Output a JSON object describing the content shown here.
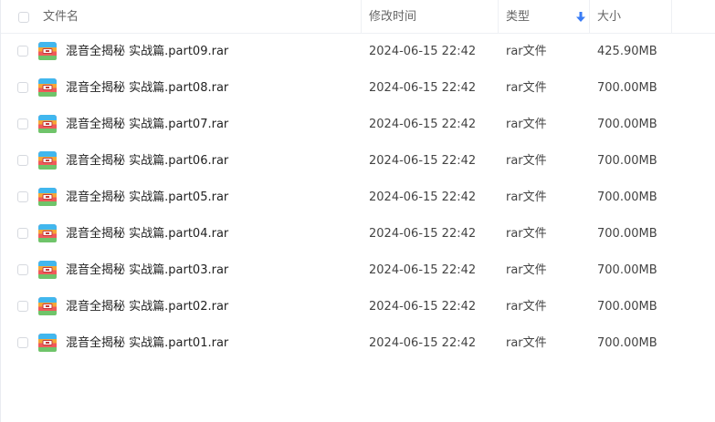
{
  "header": {
    "name": "文件名",
    "time": "修改时间",
    "type": "类型",
    "size": "大小",
    "sort_icon": "arrow-down-icon",
    "sort_color": "#3a7cf5"
  },
  "files": [
    {
      "name": "混音全揭秘 实战篇.part09.rar",
      "time": "2024-06-15 22:42",
      "type": "rar文件",
      "size": "425.90MB",
      "icon": "rar-archive-icon"
    },
    {
      "name": "混音全揭秘 实战篇.part08.rar",
      "time": "2024-06-15 22:42",
      "type": "rar文件",
      "size": "700.00MB",
      "icon": "rar-archive-icon"
    },
    {
      "name": "混音全揭秘 实战篇.part07.rar",
      "time": "2024-06-15 22:42",
      "type": "rar文件",
      "size": "700.00MB",
      "icon": "rar-archive-icon"
    },
    {
      "name": "混音全揭秘 实战篇.part06.rar",
      "time": "2024-06-15 22:42",
      "type": "rar文件",
      "size": "700.00MB",
      "icon": "rar-archive-icon"
    },
    {
      "name": "混音全揭秘 实战篇.part05.rar",
      "time": "2024-06-15 22:42",
      "type": "rar文件",
      "size": "700.00MB",
      "icon": "rar-archive-icon"
    },
    {
      "name": "混音全揭秘 实战篇.part04.rar",
      "time": "2024-06-15 22:42",
      "type": "rar文件",
      "size": "700.00MB",
      "icon": "rar-archive-icon"
    },
    {
      "name": "混音全揭秘 实战篇.part03.rar",
      "time": "2024-06-15 22:42",
      "type": "rar文件",
      "size": "700.00MB",
      "icon": "rar-archive-icon"
    },
    {
      "name": "混音全揭秘 实战篇.part02.rar",
      "time": "2024-06-15 22:42",
      "type": "rar文件",
      "size": "700.00MB",
      "icon": "rar-archive-icon"
    },
    {
      "name": "混音全揭秘 实战篇.part01.rar",
      "time": "2024-06-15 22:42",
      "type": "rar文件",
      "size": "700.00MB",
      "icon": "rar-archive-icon"
    }
  ]
}
